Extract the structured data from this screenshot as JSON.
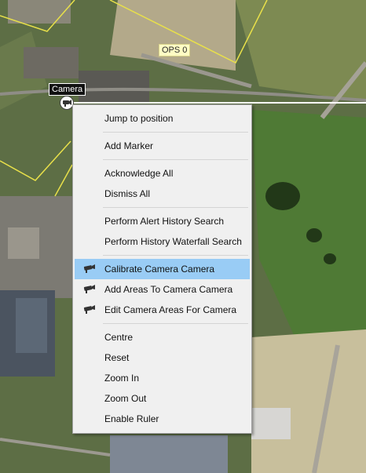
{
  "map": {
    "ops_label": "OPS 0",
    "camera_label": "Camera"
  },
  "context_menu": {
    "groups": [
      {
        "items": [
          {
            "label": "Jump to position"
          }
        ]
      },
      {
        "items": [
          {
            "label": "Add Marker"
          }
        ]
      },
      {
        "items": [
          {
            "label": "Acknowledge All"
          },
          {
            "label": "Dismiss All"
          }
        ]
      },
      {
        "items": [
          {
            "label": "Perform Alert History Search"
          },
          {
            "label": "Perform History Waterfall Search"
          }
        ]
      },
      {
        "items": [
          {
            "label": "Calibrate Camera Camera",
            "icon": "camera-icon",
            "highlighted": true
          },
          {
            "label": "Add Areas To Camera Camera",
            "icon": "camera-icon"
          },
          {
            "label": "Edit Camera Areas For Camera",
            "icon": "camera-icon"
          }
        ]
      },
      {
        "items": [
          {
            "label": "Centre"
          },
          {
            "label": "Reset"
          },
          {
            "label": "Zoom In"
          },
          {
            "label": "Zoom Out"
          },
          {
            "label": "Enable Ruler"
          }
        ]
      }
    ]
  },
  "colors": {
    "highlight": "#99ccf5",
    "menu_background": "#f0f0f0",
    "boundary_line": "#e8e04a"
  }
}
